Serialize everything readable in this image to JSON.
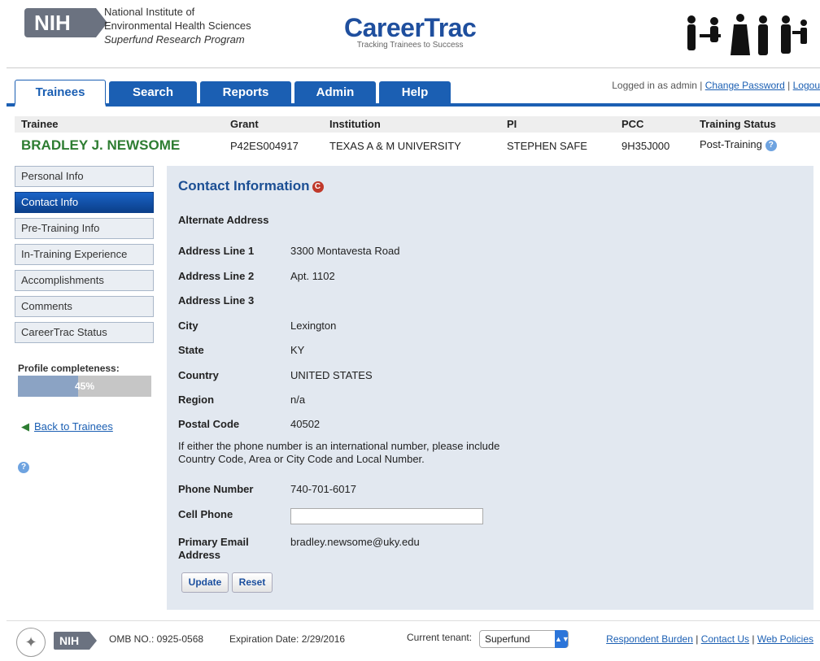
{
  "header": {
    "nih_logo": "NIH",
    "institute_line1": "National Institute of",
    "institute_line2": "Environmental Health Sciences",
    "program": "Superfund Research Program",
    "app_name": "CareerTrac",
    "tagline": "Tracking Trainees to Success"
  },
  "tabs": [
    "Trainees",
    "Search",
    "Reports",
    "Admin",
    "Help"
  ],
  "login": {
    "text": "Logged in as admin | ",
    "change_password": "Change Password",
    "sep": " | ",
    "logout": "Logou"
  },
  "trainee": {
    "headers": [
      "Trainee",
      "Grant",
      "Institution",
      "PI",
      "PCC",
      "Training Status"
    ],
    "name": "BRADLEY J. NEWSOME",
    "grant": "P42ES004917",
    "institution": "TEXAS A & M UNIVERSITY",
    "pi": "STEPHEN SAFE",
    "pcc": "9H35J000",
    "status": "Post-Training",
    "help_icon": "question-icon"
  },
  "sidebar": {
    "items": [
      "Personal Info",
      "Contact Info",
      "Pre-Training Info",
      "In-Training Experience",
      "Accomplishments",
      "Comments",
      "CareerTrac Status"
    ],
    "active_index": 1,
    "profile_label": "Profile completeness:",
    "profile_value": "45%",
    "profile_fraction": 0.45,
    "back_link": "Back to Trainees"
  },
  "contact": {
    "title": "Contact Information",
    "title_icon": "C",
    "section": "Alternate Address",
    "fields": [
      {
        "label": "Address Line 1",
        "value": "3300 Montavesta Road"
      },
      {
        "label": "Address Line 2",
        "value": "Apt. 1102"
      },
      {
        "label": "Address Line 3",
        "value": ""
      },
      {
        "label": "City",
        "value": "Lexington"
      },
      {
        "label": "State",
        "value": "KY"
      },
      {
        "label": "Country",
        "value": "UNITED STATES"
      },
      {
        "label": "Region",
        "value": "n/a"
      },
      {
        "label": "Postal Code",
        "value": "40502"
      }
    ],
    "note": "If either the phone number is an international number, please include Country Code, Area or City Code and Local Number.",
    "phone_label": "Phone Number",
    "phone_value": "740-701-6017",
    "cell_label": "Cell Phone",
    "cell_value": "",
    "email_label": "Primary Email Address",
    "email_value": "bradley.newsome@uky.edu",
    "update_button": "Update",
    "reset_button": "Reset"
  },
  "footer": {
    "omb": "OMB NO.: 0925-0568",
    "expiration": "Expiration Date: 2/29/2016",
    "tenant_label": "Current tenant:",
    "tenant_value": "Superfund",
    "links": [
      "Respondent Burden",
      "Contact Us",
      "Web Policies"
    ]
  },
  "colors": {
    "primary_blue": "#1b5fb3",
    "trainee_green": "#2e7d32",
    "panel_bg": "#e2e8f0"
  }
}
